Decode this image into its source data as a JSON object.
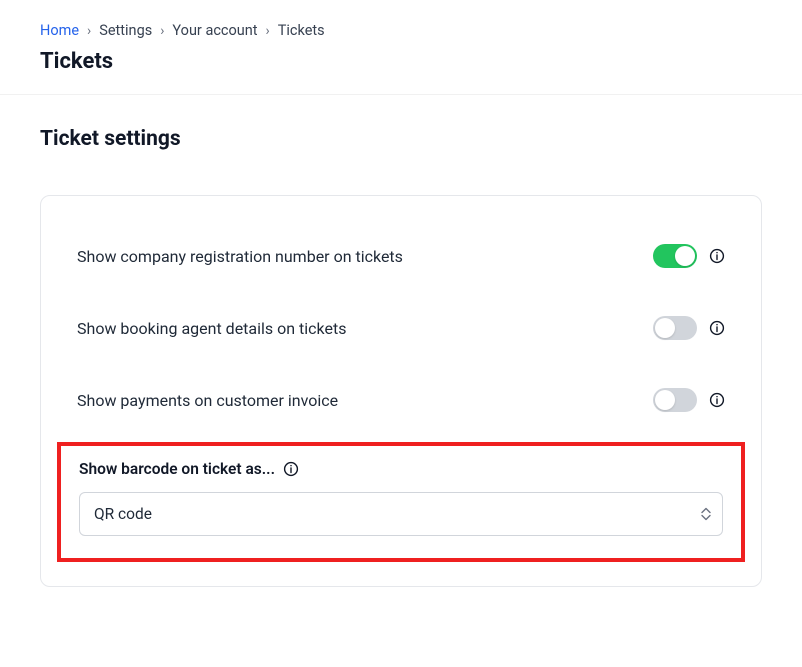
{
  "breadcrumb": {
    "home": "Home",
    "settings": "Settings",
    "your_account": "Your account",
    "tickets": "Tickets"
  },
  "page_title": "Tickets",
  "section_title": "Ticket settings",
  "settings": {
    "company_reg": {
      "label": "Show company registration number on tickets",
      "enabled": true
    },
    "booking_agent": {
      "label": "Show booking agent details on tickets",
      "enabled": false
    },
    "payments_invoice": {
      "label": "Show payments on customer invoice",
      "enabled": false
    },
    "barcode": {
      "label": "Show barcode on ticket as...",
      "value": "QR code"
    }
  }
}
